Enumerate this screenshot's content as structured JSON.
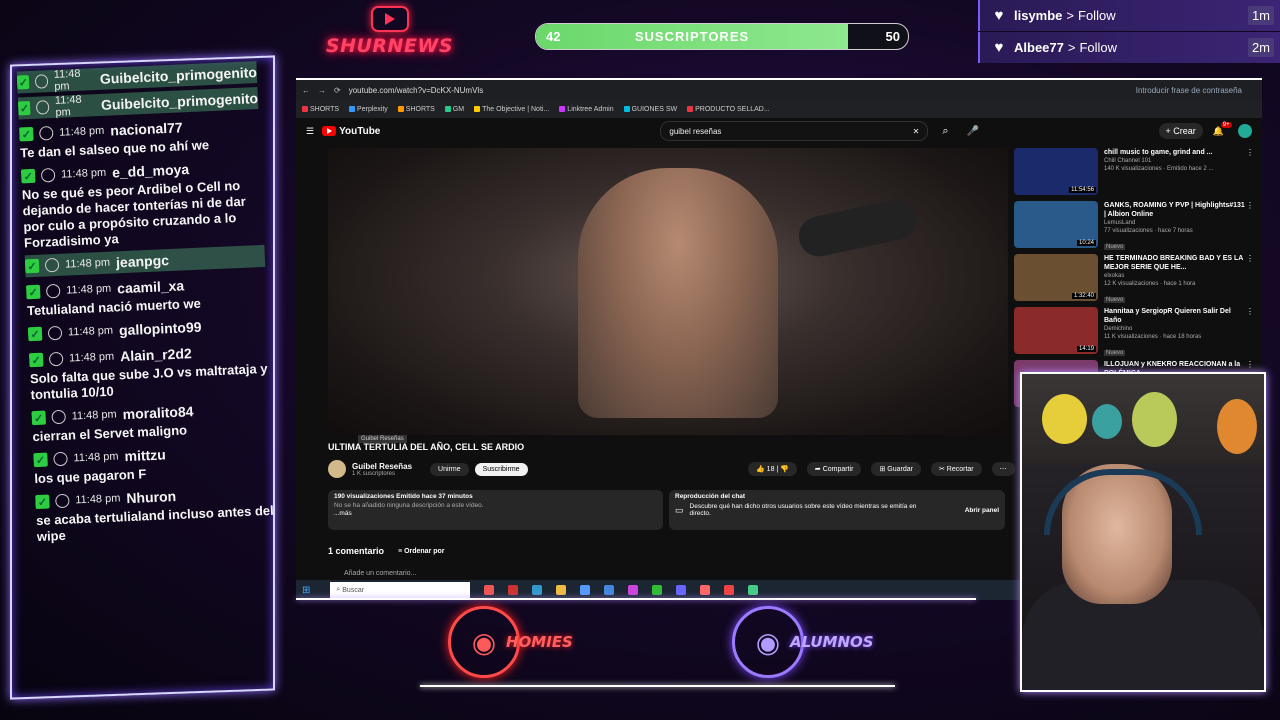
{
  "overlay": {
    "channel_logo_text": "SHURNEWS",
    "sub_goal": {
      "current": "42",
      "label": "SUSCRIPTORES",
      "goal": "50",
      "progress": 0.84
    },
    "follows": [
      {
        "name": "lisymbe",
        "action": "Follow",
        "time": "1m"
      },
      {
        "name": "Albee77",
        "action": "Follow",
        "time": "2m"
      }
    ],
    "teams": [
      {
        "name": "HOMIES"
      },
      {
        "name": "ALUMNOS"
      }
    ]
  },
  "chat": {
    "messages": [
      {
        "time": "11:48 pm",
        "user": "Guibelcito_primogenito",
        "text": "",
        "highlight": true
      },
      {
        "time": "11:48 pm",
        "user": "Guibelcito_primogenito",
        "text": "",
        "highlight": true
      },
      {
        "time": "11:48 pm",
        "user": "nacional77",
        "text": "Te dan el salseo que no ahí we",
        "highlight": false
      },
      {
        "time": "11:48 pm",
        "user": "e_dd_moya",
        "text": "No se qué es peor Ardibel o Cell no dejando de hacer tonterías ni de dar por culo a propósito cruzando a lo Forzadisimo ya",
        "highlight": false
      },
      {
        "time": "11:48 pm",
        "user": "jeanpgc",
        "text": "",
        "highlight": true
      },
      {
        "time": "11:48 pm",
        "user": "caamil_xa",
        "text": "Tetulialand nació muerto we",
        "highlight": false
      },
      {
        "time": "11:48 pm",
        "user": "gallopinto99",
        "text": "",
        "highlight": false
      },
      {
        "time": "11:48 pm",
        "user": "Alain_r2d2",
        "text": "Solo falta que sube J.O vs maltrataja y tontulia 10/10",
        "highlight": false
      },
      {
        "time": "11:48 pm",
        "user": "moralito84",
        "text": "cierran el Servet maligno",
        "highlight": false
      },
      {
        "time": "11:48 pm",
        "user": "mittzu",
        "text": "los que pagaron F",
        "highlight": false
      },
      {
        "time": "11:48 pm",
        "user": "Nhuron",
        "text": "se acaba tertulialand incluso antes del wipe",
        "highlight": false
      }
    ]
  },
  "browser": {
    "url": "youtube.com/watch?v=DcKX-NUmVls",
    "password_hint": "Introducir frase de contraseña",
    "bookmarks": [
      "SHORTS",
      "Perplexity",
      "SHORTS",
      "GM",
      "The Objective | Noti...",
      "Linktree Admin",
      "GUIONES SW",
      "PRODUCTO SELLAD..."
    ],
    "bookmark_colors": [
      "#e34",
      "#39f",
      "#f90",
      "#2c8",
      "#fc0",
      "#c3f",
      "#0bd",
      "#e34"
    ],
    "yt_logo": "YouTube",
    "search_query": "guibel reseñas",
    "create_label": "Crear",
    "notif_count": "9+",
    "video_title": "ULTIMA TERTULIA DEL AÑO, CELL SE ARDIO",
    "video_overlay_text": "Guibel Reseñas",
    "channel": {
      "name": "Guibel Reseñas",
      "subs": "1 K suscriptores",
      "join": "Unirme",
      "subscribe": "Suscribirme"
    },
    "actions": {
      "likes": "18",
      "share": "Compartir",
      "save": "Guardar",
      "clip": "Recortar"
    },
    "description": {
      "meta": "190 visualizaciones  Emitido hace 37 minutos",
      "text": "No se ha añadido ninguna descripción a este vídeo.",
      "more": "...más"
    },
    "chat_replay": {
      "title": "Reproducción del chat",
      "text": "Descubre qué han dicho otros usuarios sobre este vídeo mientras se emitía en directo.",
      "open": "Abrir panel"
    },
    "comments": {
      "count_label": "1 comentario",
      "sort_label": "Ordenar por",
      "add_placeholder": "Añade un comentario..."
    },
    "recommended": [
      {
        "title": "chill music to game, grind and ...",
        "channel": "Chill Channel 101",
        "meta": "140 K visualizaciones · Emitido hace 2 ...",
        "duration": "11:54:56",
        "color": "#1a2a6a"
      },
      {
        "title": "GANKS, ROAMING Y PVP | Highlights#131 | Albion Online",
        "channel": "LemusLand",
        "meta": "77 visualizaciones · hace 7 horas",
        "duration": "10:24",
        "color": "#2a5a8a"
      },
      {
        "title": "HE TERMINADO BREAKING BAD Y ES LA MEJOR SERIE QUE HE...",
        "channel": "elxokas",
        "meta": "12 K visualizaciones · hace 1 hora",
        "duration": "1:32:40",
        "color": "#6a5030"
      },
      {
        "title": "Hannitaa y SergiopR Quieren Salir Del Baño",
        "channel": "Demichino",
        "meta": "11 K visualizaciones · hace 18 horas",
        "duration": "14:19",
        "color": "#8a2a2a"
      },
      {
        "title": "ILLOJUAN y KNEKRO REACCIONAN a la POLÉMICA ...",
        "channel": "",
        "meta": "",
        "duration": "",
        "color": "#7a3a6a"
      }
    ],
    "recommended_badge": "Nuevo",
    "taskbar_search": "Buscar"
  }
}
